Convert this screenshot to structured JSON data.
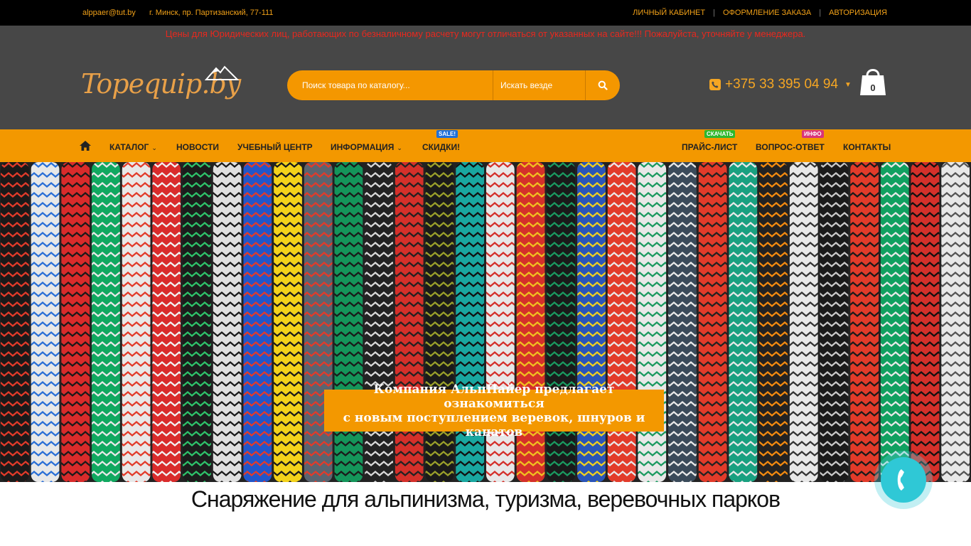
{
  "topbar": {
    "email": "alppaer@tut.by",
    "address": "г. Минск, пр. Партизанский, 77-111",
    "links": [
      "ЛИЧНЫЙ КАБИНЕТ",
      "ОФОРМЛЕНИЕ ЗАКАЗА",
      "АВТОРИЗАЦИЯ"
    ]
  },
  "header": {
    "notice": "Цены для Юридических лиц, работающих по безналичному расчету могут отличаться от указанных на сайте!!! Пожалуйста, уточняйте у менеджера.",
    "logo_text": "Topequip.by",
    "logo_sub": "АльпПайер",
    "search_placeholder": "Поиск товара по каталогу...",
    "search_scope": "Искать везде",
    "phone": "+375 33 395 04 94",
    "cart_count": "0"
  },
  "nav": {
    "catalog": "КАТАЛОГ",
    "news": "НОВОСТИ",
    "training": "УЧЕБНЫЙ ЦЕНТР",
    "info": "ИНФОРМАЦИЯ",
    "discounts": "СКИДКИ!",
    "discounts_badge": "SALE!",
    "pricelist": "ПРАЙС-ЛИСТ",
    "pricelist_badge": "СКАЧАТЬ",
    "faq": "ВОПРОС-ОТВЕТ",
    "faq_badge": "ИНФО",
    "contacts": "КОНТАКТЫ"
  },
  "banner": {
    "caption_line1": "Компания АльпПайер предлагает ознакомиться",
    "caption_line2": "с новым поступлением веревок, шнуров и канатов"
  },
  "slogan": "Снаряжение для альпинизма, туризма, веревочных парков",
  "colors": {
    "accent": "#f39800",
    "header_bg": "#474747",
    "notice": "#e8281e",
    "badge_sale": "#1e6fd9",
    "badge_download": "#2db82d",
    "badge_info": "#d9347a",
    "call_button": "#2fc8d6"
  },
  "icons": {
    "home": "home-icon",
    "search": "search-icon",
    "phone": "phone-icon",
    "cart": "shopping-bag-icon",
    "call": "phone-handset-icon"
  }
}
